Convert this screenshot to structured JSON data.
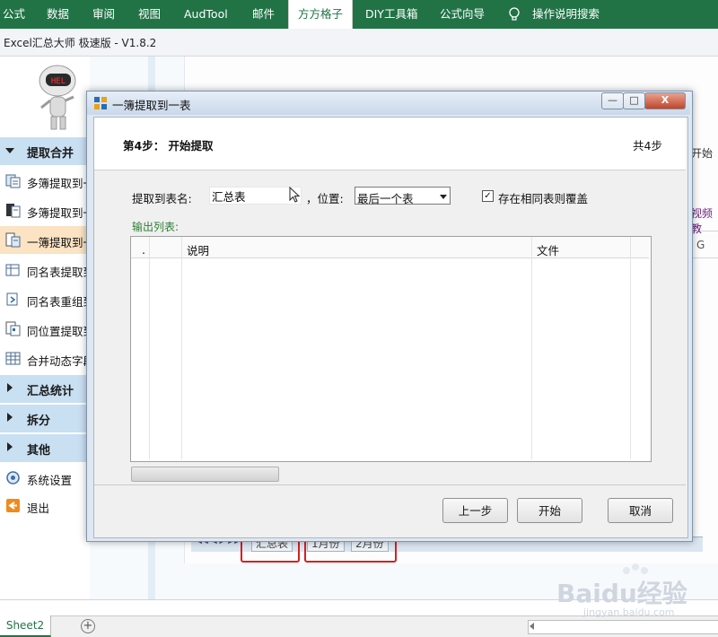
{
  "ribbon": {
    "tabs": [
      "公式",
      "数据",
      "审阅",
      "视图",
      "AudTool",
      "邮件",
      "方方格子",
      "DIY工具箱",
      "公式向导"
    ],
    "active_tab": "方方格子",
    "search_label": "操作说明搜索",
    "accent_color": "#217346"
  },
  "addin": {
    "title": "Excel汇总大师 极速版 - V1.8.2"
  },
  "sidebar": {
    "sections": [
      {
        "label": "提取合并",
        "expanded": true
      },
      {
        "label": "汇总统计",
        "expanded": false
      },
      {
        "label": "拆分",
        "expanded": false
      },
      {
        "label": "其他",
        "expanded": false
      }
    ],
    "items": [
      {
        "label": "多簿提取到一",
        "icon": "multi-workbook-icon"
      },
      {
        "label": "多簿提取到一",
        "icon": "multi-workbook-sheet-icon"
      },
      {
        "label": "一簿提取到一",
        "icon": "single-workbook-icon",
        "selected": true
      },
      {
        "label": "同名表提取到",
        "icon": "same-name-sheet-icon"
      },
      {
        "label": "同名表重组到",
        "icon": "regroup-sheet-icon"
      },
      {
        "label": "同位置提取到",
        "icon": "same-position-icon"
      },
      {
        "label": "合并动态字段",
        "icon": "table-merge-icon"
      }
    ],
    "others": [
      {
        "label": "系统设置",
        "icon": "settings-icon"
      },
      {
        "label": "退出",
        "icon": "exit-icon"
      }
    ]
  },
  "background": {
    "start_text": "开始",
    "link_text": "视频教",
    "column_label": "G",
    "sheet_tabs": [
      "汇总表",
      "1月份",
      "2月份"
    ]
  },
  "dialog": {
    "title": "一簿提取到一表",
    "step_title": "第4步： 开始提取",
    "step_total": "共4步",
    "target_label": "提取到表名:",
    "target_value": "汇总表",
    "position_label": "，位置:",
    "position_value": "最后一个表",
    "overwrite_label": "存在相同表则覆盖",
    "overwrite_checked": true,
    "output_label": "输出列表:",
    "columns": [
      ".",
      "",
      "说明",
      "文件"
    ],
    "buttons": {
      "prev": "上一步",
      "start": "开始",
      "cancel": "取消"
    },
    "window_controls": {
      "minimize": "—",
      "maximize": "□",
      "close": "X"
    }
  },
  "excel": {
    "sheet_tab": "Sheet2",
    "add_sheet": "+"
  },
  "watermark": {
    "text": "Baidu经验",
    "url": "jingyan.baidu.com"
  }
}
